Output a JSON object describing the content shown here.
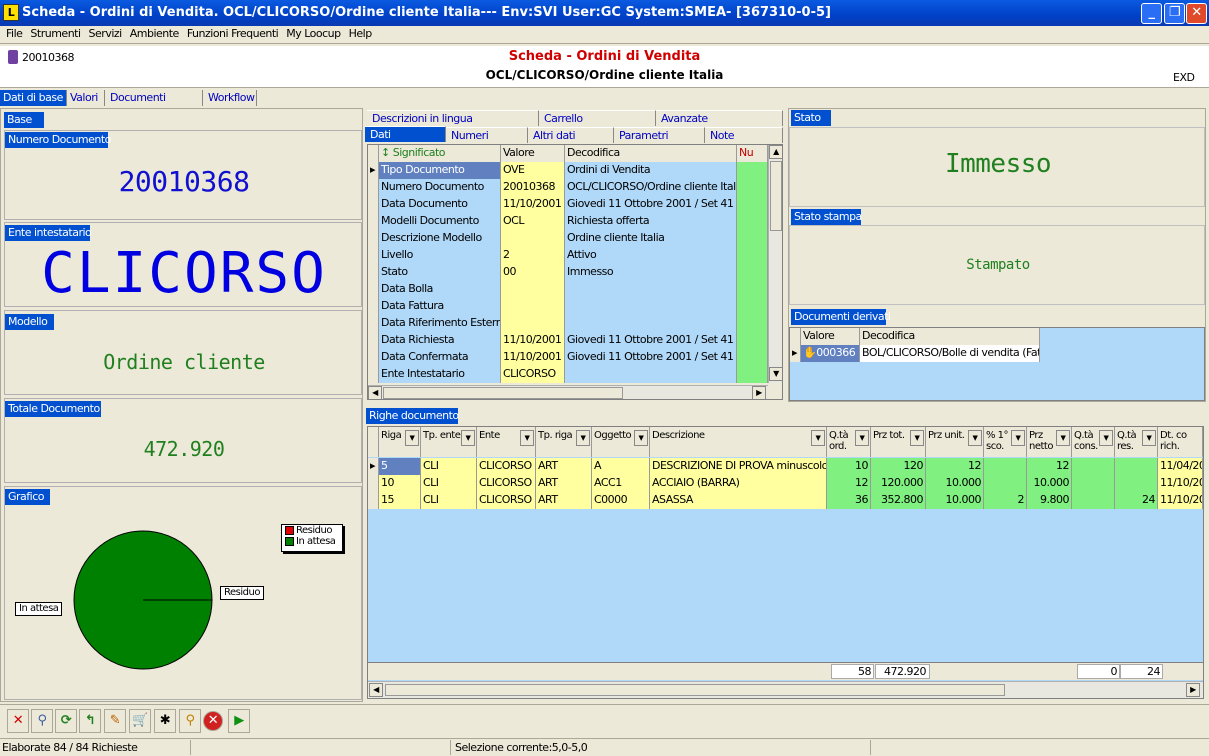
{
  "window": {
    "title": "Scheda - Ordini di Vendita. OCL/CLICORSO/Ordine cliente Italia--- Env:SVI User:GC System:SMEA- [367310-0-5]",
    "icon": "L"
  },
  "menu": [
    "File",
    "Strumenti",
    "Servizi",
    "Ambiente",
    "Funzioni Frequenti",
    "My Loocup",
    "Help"
  ],
  "header": {
    "doc_number": "20010368",
    "title": "Scheda - Ordini di Vendita",
    "subtitle": "OCL/CLICORSO/Ordine cliente Italia",
    "right_code": "EXD"
  },
  "main_tabs": [
    "Dati di base",
    "Valori",
    "Documenti Correlati",
    "Workflow"
  ],
  "left": {
    "base_label": "Base",
    "numero_label": "Numero Documento",
    "numero_value": "20010368",
    "ente_label": "Ente intestatario",
    "ente_value": "CLICORSO",
    "modello_label": "Modello",
    "modello_value": "Ordine cliente",
    "totale_label": "Totale Documento",
    "totale_value": "472.920",
    "grafico_label": "Grafico",
    "chart": {
      "legend": [
        {
          "name": "Residuo",
          "color": "#e00000"
        },
        {
          "name": "In attesa",
          "color": "#008000"
        }
      ],
      "callout_left": "In attesa",
      "callout_right": "Residuo",
      "values": {
        "Residuo": 0,
        "In attesa": 100
      }
    }
  },
  "center_tabs_top": [
    "Descrizioni in lingua",
    "Carrello",
    "Avanzate"
  ],
  "center_tabs_bottom": [
    "Dati",
    "Numeri",
    "Altri dati",
    "Parametri",
    "Note"
  ],
  "dati_grid": {
    "headers": [
      "Significato",
      "Valore",
      "Decodifica",
      "Nu"
    ],
    "rows": [
      [
        "Tipo Documento",
        "OVE",
        "Ordini di Vendita"
      ],
      [
        "Numero Documento",
        "20010368",
        "OCL/CLICORSO/Ordine cliente Italia"
      ],
      [
        "Data Documento",
        "11/10/2001",
        "Giovedi 11 Ottobre 2001 / Set 41"
      ],
      [
        "Modelli Documento",
        "OCL",
        "Richiesta offerta"
      ],
      [
        "Descrizione Modello",
        "",
        "Ordine cliente Italia"
      ],
      [
        "Livello",
        "2",
        "Attivo"
      ],
      [
        "Stato",
        "00",
        "Immesso"
      ],
      [
        "Data Bolla",
        "",
        ""
      ],
      [
        "Data Fattura",
        "",
        ""
      ],
      [
        "Data Riferimento Esterno",
        "",
        ""
      ],
      [
        "Data Richiesta",
        "11/10/2001",
        "Giovedi 11 Ottobre 2001 / Set 41"
      ],
      [
        "Data Confermata",
        "11/10/2001",
        "Giovedi 11 Ottobre 2001 / Set 41"
      ],
      [
        "Ente Intestatario",
        "CLICORSO",
        ""
      ]
    ]
  },
  "right": {
    "stato_label": "Stato",
    "stato_value": "Immesso",
    "stampa_label": "Stato stampa",
    "stampa_value": "Stampato",
    "derivati_label": "Documenti derivati",
    "derivati_headers": [
      "Valore",
      "Decodifica"
    ],
    "derivati_rows": [
      [
        "000366",
        "BOL/CLICORSO/Bolle di vendita (Fatt"
      ]
    ]
  },
  "righe": {
    "label": "Righe documento",
    "headers": [
      "Riga",
      "Tp. ente",
      "Ente",
      "Tp. riga",
      "Oggetto",
      "Descrizione",
      "Q.tà ord.",
      "Prz tot.",
      "Prz unit.",
      "% 1° sco.",
      "Prz netto",
      "Q.tà cons.",
      "Q.tà res.",
      "Dt. co rich."
    ],
    "rows": [
      [
        "5",
        "CLI",
        "CLICORSO",
        "ART",
        "A",
        "DESCRIZIONE DI PROVA  minuscolo",
        "10",
        "120",
        "12",
        "",
        "12",
        "",
        "",
        "11/04/20"
      ],
      [
        "10",
        "CLI",
        "CLICORSO",
        "ART",
        "ACC1",
        "ACCIAIO (BARRA)",
        "12",
        "120.000",
        "10.000",
        "",
        "10.000",
        "",
        "",
        "11/10/20"
      ],
      [
        "15",
        "CLI",
        "CLICORSO",
        "ART",
        "C0000",
        "ASASSA",
        "36",
        "352.800",
        "10.000",
        "2",
        "9.800",
        "",
        "24",
        "11/10/20"
      ]
    ],
    "totals": {
      "qta": "58",
      "prz_tot": "472.920",
      "cons": "0",
      "res": "24"
    }
  },
  "toolbar": [
    "close-icon",
    "search-icon",
    "refresh-icon",
    "back-arrow-icon",
    "edit-icon",
    "cart-icon",
    "options-icon",
    "zoom-icon",
    "cancel-icon",
    "play-icon"
  ],
  "status": {
    "left": "Elaborate 84 / 84 Richieste",
    "center": "Selezione corrente:5,0-5,0"
  }
}
